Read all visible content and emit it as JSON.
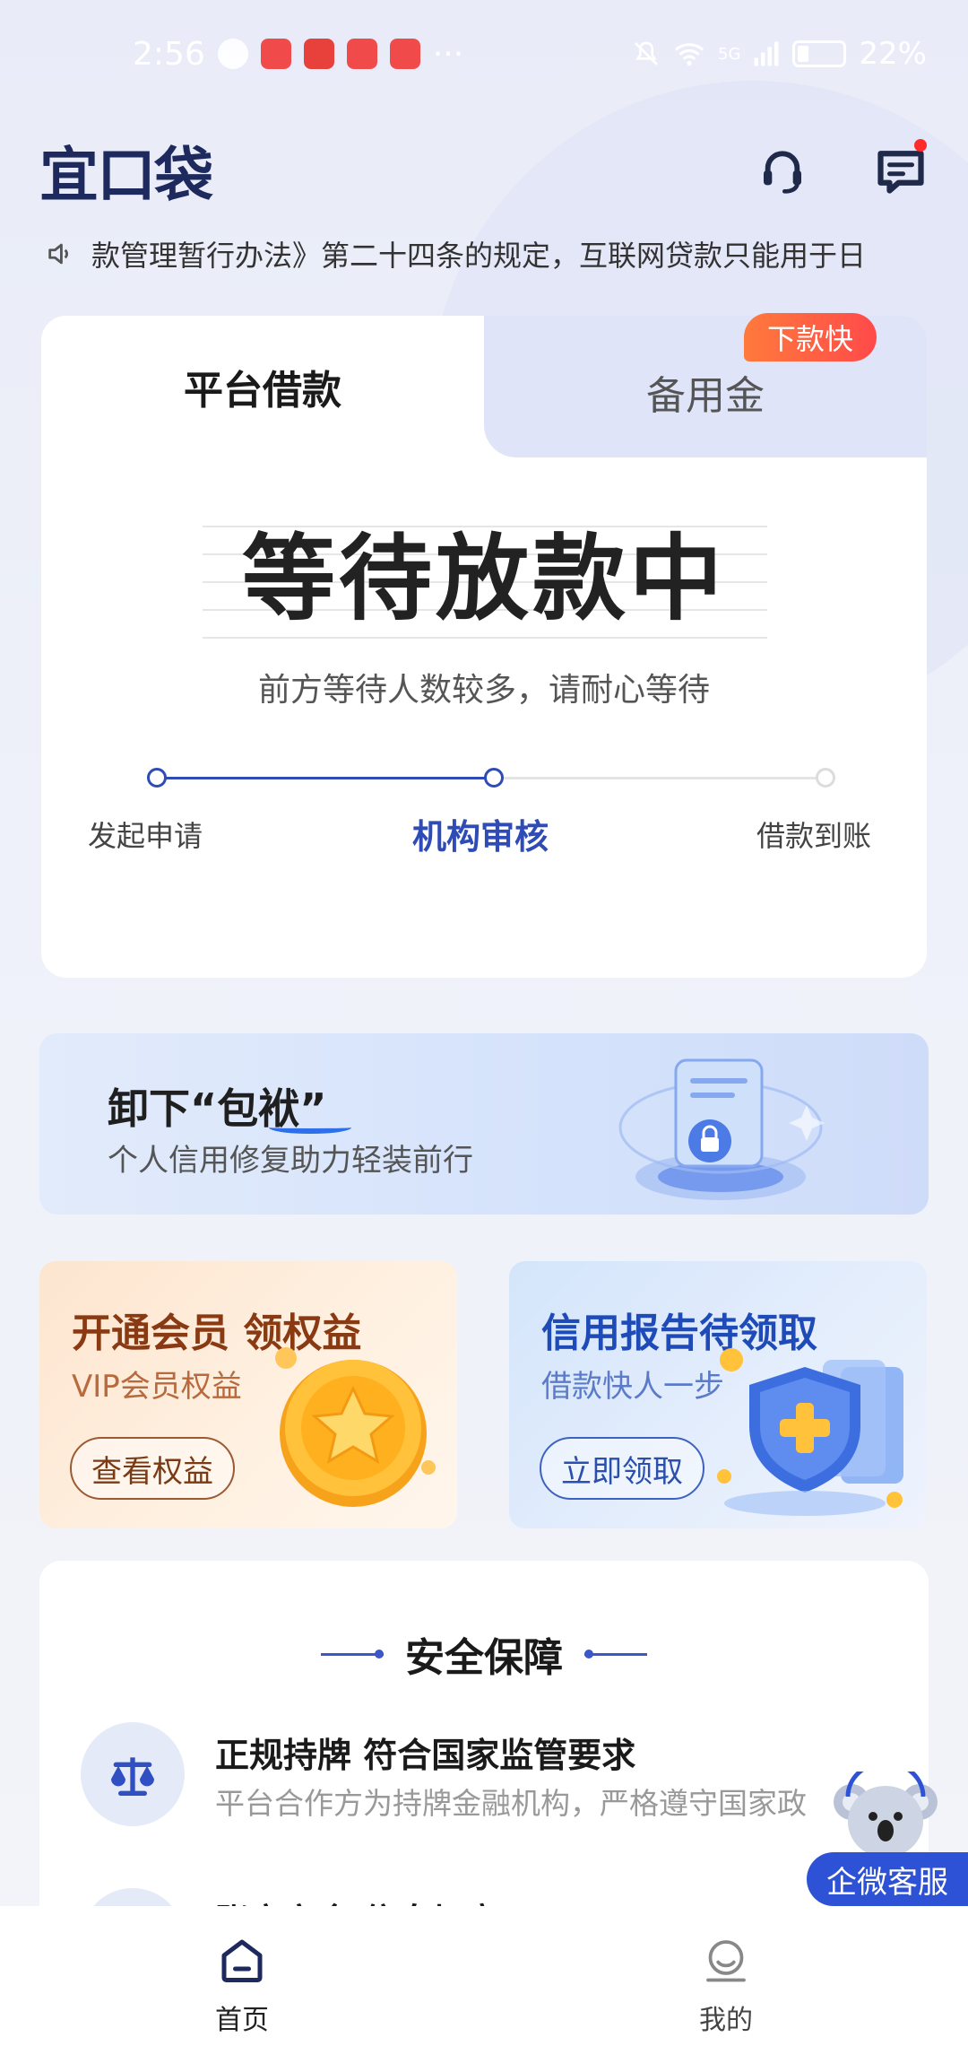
{
  "status_bar": {
    "time": "2:56",
    "more": "···",
    "network": "5G",
    "battery": "22%"
  },
  "header": {
    "logo": "宜口袋",
    "icons": [
      "headset-icon",
      "message-icon"
    ]
  },
  "notice": {
    "text": "款管理暂行办法》第二十四条的规定，互联网贷款只能用于日"
  },
  "main_card": {
    "tabs": [
      {
        "label": "平台借款",
        "active": true
      },
      {
        "label": "备用金",
        "active": false,
        "badge": "下款快"
      }
    ],
    "status_title": "等待放款中",
    "status_subtitle": "前方等待人数较多，请耐心等待",
    "steps": [
      {
        "label": "发起申请",
        "state": "done"
      },
      {
        "label": "机构审核",
        "state": "current"
      },
      {
        "label": "借款到账",
        "state": "todo"
      }
    ]
  },
  "banner": {
    "title": "卸下“包袱”",
    "subtitle": "个人信用修复助力轻装前行"
  },
  "promos": [
    {
      "title": "开通会员 领权益",
      "subtitle": "VIP会员权益",
      "button": "查看权益"
    },
    {
      "title": "信用报告待领取",
      "subtitle": "借款快人一步",
      "button": "立即领取"
    }
  ],
  "security": {
    "title": "安全保障",
    "items": [
      {
        "title": "正规持牌 符合国家监管要求",
        "desc": "平台合作方为持牌金融机构，严格遵守国家政"
      },
      {
        "title": "账户安全 信息加密",
        "desc": ""
      }
    ]
  },
  "float_service": {
    "label": "企微客服"
  },
  "bottom_nav": {
    "items": [
      {
        "label": "首页",
        "active": true
      },
      {
        "label": "我的",
        "active": false
      }
    ]
  },
  "colors": {
    "brand": "#1e2a5e",
    "accent": "#2e4bb6",
    "badge": "#ff5a3c",
    "service": "#2d52d6"
  }
}
